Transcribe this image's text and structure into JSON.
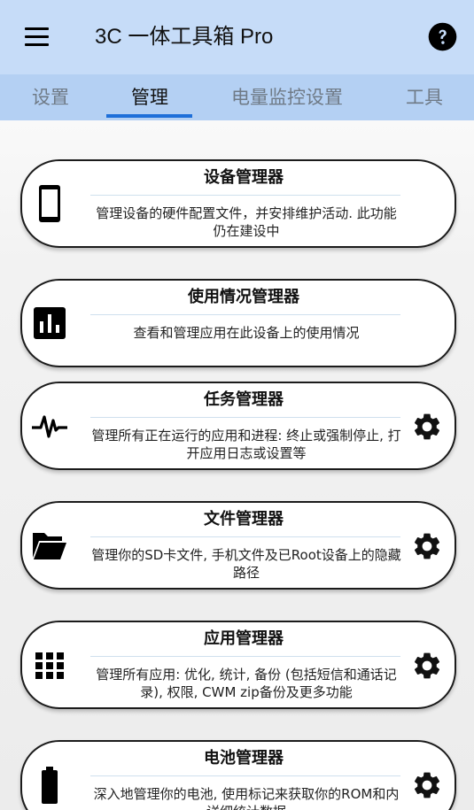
{
  "app": {
    "title": "3C 一体工具箱 Pro",
    "menu_icon": "menu-icon",
    "help_icon": "help-circle-icon"
  },
  "tabs": [
    {
      "label": "设置",
      "active": false
    },
    {
      "label": "管理",
      "active": true
    },
    {
      "label": "电量监控设置",
      "active": false
    },
    {
      "label": "工具",
      "active": false
    }
  ],
  "colors": {
    "appbar": "#c6dcf8",
    "tabbar": "#b4d0f3",
    "tab_indicator": "#1e6fd9"
  },
  "cards": [
    {
      "title": "设备管理器",
      "desc": "管理设备的硬件配置文件，并安排维护活动. 此功能仍在建设中",
      "icon": "smartphone-icon",
      "has_settings": false
    },
    {
      "title": "使用情况管理器",
      "desc": "查看和管理应用在此设备上的使用情况",
      "icon": "bar-chart-icon",
      "has_settings": false
    },
    {
      "title": "任务管理器",
      "desc": "管理所有正在运行的应用和进程: 终止或强制停止, 打开应用日志或设置等",
      "icon": "pulse-icon",
      "has_settings": true
    },
    {
      "title": "文件管理器",
      "desc": "管理你的SD卡文件, 手机文件及已Root设备上的隐藏路径",
      "icon": "folder-open-icon",
      "has_settings": true
    },
    {
      "title": "应用管理器",
      "desc": "管理所有应用: 优化, 统计, 备份 (包括短信和通话记录), 权限, CWM zip备份及更多功能",
      "icon": "apps-grid-icon",
      "has_settings": true
    },
    {
      "title": "电池管理器",
      "desc": "深入地管理你的电池, 使用标记来获取你的ROM和内详细统计数据",
      "icon": "battery-icon",
      "has_settings": true
    }
  ]
}
